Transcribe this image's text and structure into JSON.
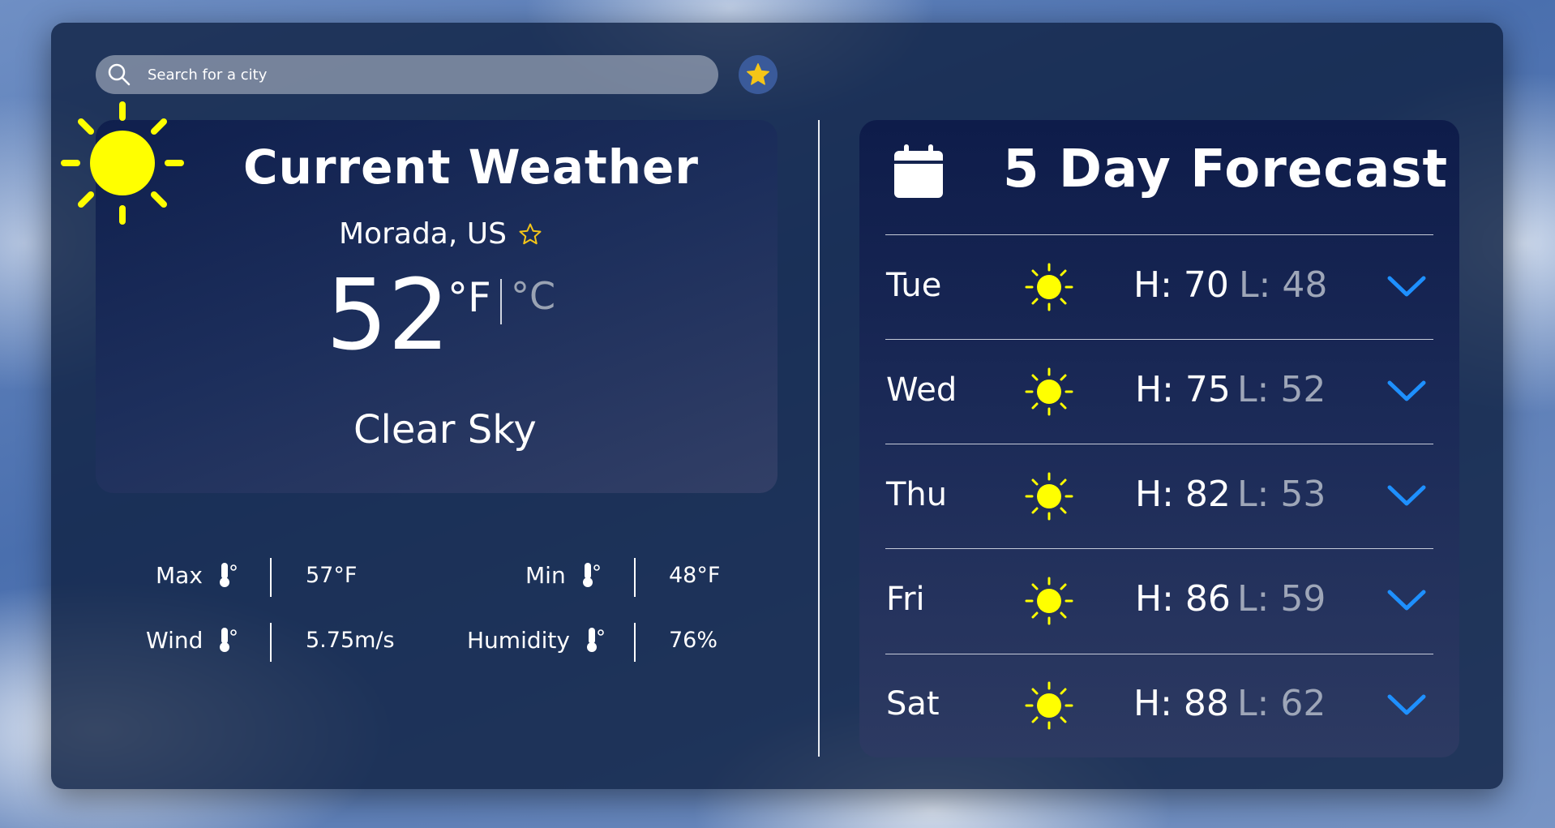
{
  "search": {
    "placeholder": "Search for a city"
  },
  "current": {
    "title": "Current Weather",
    "location": "Morada, US",
    "temperature": "52",
    "unit_f": "°F",
    "unit_c": "°C",
    "description": "Clear Sky"
  },
  "stats": {
    "max_label": "Max",
    "max_value": "57°F",
    "min_label": "Min",
    "min_value": "48°F",
    "wind_label": "Wind",
    "wind_value": "5.75m/s",
    "humidity_label": "Humidity",
    "humidity_value": "76%"
  },
  "forecast": {
    "title": "5 Day Forecast",
    "days": [
      {
        "day": "Tue",
        "high": "H: 70",
        "low": "L: 48"
      },
      {
        "day": "Wed",
        "high": "H: 75",
        "low": "L: 52"
      },
      {
        "day": "Thu",
        "high": "H: 82",
        "low": "L: 53"
      },
      {
        "day": "Fri",
        "high": "H: 86",
        "low": "L: 59"
      },
      {
        "day": "Sat",
        "high": "H: 88",
        "low": "L: 62"
      }
    ]
  },
  "colors": {
    "sun": "#ffff00",
    "star": "#f5c518",
    "chevron": "#1e90ff",
    "low_text": "#9ea6b8"
  },
  "icons": [
    "search-icon",
    "star-icon",
    "sun-icon",
    "thermometer-icon",
    "calendar-icon",
    "chevron-down-icon"
  ]
}
